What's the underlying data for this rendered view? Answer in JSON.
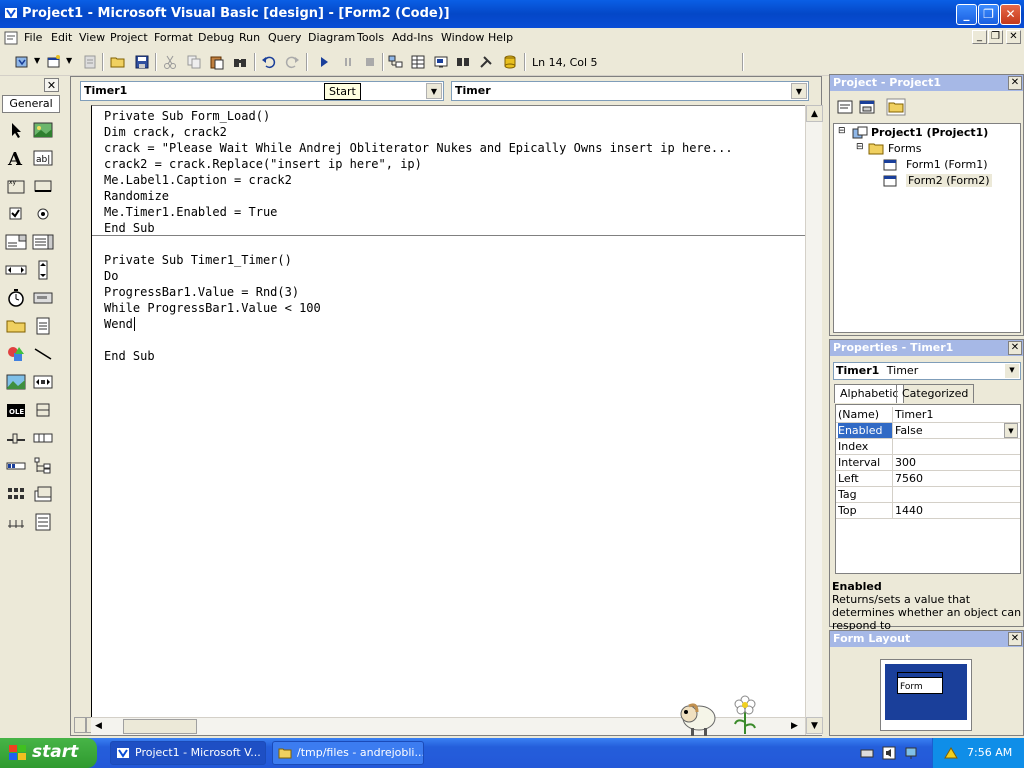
{
  "window": {
    "title": "Project1 - Microsoft Visual Basic [design] - [Form2 (Code)]"
  },
  "menu": [
    "File",
    "Edit",
    "View",
    "Project",
    "Format",
    "Debug",
    "Run",
    "Query",
    "Diagram",
    "Tools",
    "Add-Ins",
    "Window",
    "Help"
  ],
  "toolbar": {
    "position": "Ln 14, Col 5"
  },
  "toolbox": {
    "tab": "General"
  },
  "code": {
    "object_combo": "Timer1",
    "proc_combo": "Timer",
    "tooltip": "Start",
    "lines": [
      "Private Sub Form_Load()",
      "Dim crack, crack2",
      "crack = \"Please Wait While Andrej Obliterator Nukes and Epically Owns insert ip here...",
      "crack2 = crack.Replace(\"insert ip here\", ip)",
      "Me.Label1.Caption = crack2",
      "Randomize",
      "Me.Timer1.Enabled = True",
      "End Sub",
      "",
      "Private Sub Timer1_Timer()",
      "Do",
      "ProgressBar1.Value = Rnd(3)",
      "While ProgressBar1.Value < 100",
      "Wend",
      "",
      "End Sub"
    ]
  },
  "project": {
    "title": "Project - Project1",
    "root": "Project1 (Project1)",
    "folder": "Forms",
    "items": [
      "Form1 (Form1)",
      "Form2 (Form2)"
    ]
  },
  "properties": {
    "title": "Properties - Timer1",
    "object_name": "Timer1",
    "object_type": "Timer",
    "tabs": [
      "Alphabetic",
      "Categorized"
    ],
    "rows": [
      {
        "name": "(Name)",
        "value": "Timer1"
      },
      {
        "name": "Enabled",
        "value": "False"
      },
      {
        "name": "Index",
        "value": ""
      },
      {
        "name": "Interval",
        "value": "300"
      },
      {
        "name": "Left",
        "value": "7560"
      },
      {
        "name": "Tag",
        "value": ""
      },
      {
        "name": "Top",
        "value": "1440"
      }
    ],
    "desc_title": "Enabled",
    "desc_text": "Returns/sets a value that determines whether an object can respond to"
  },
  "form_layout": {
    "title": "Form Layout",
    "form_label": "Form"
  },
  "taskbar": {
    "start": "start",
    "tasks": [
      "Project1 - Microsoft V...",
      "/tmp/files - andrejobli..."
    ],
    "clock": "7:56 AM"
  }
}
